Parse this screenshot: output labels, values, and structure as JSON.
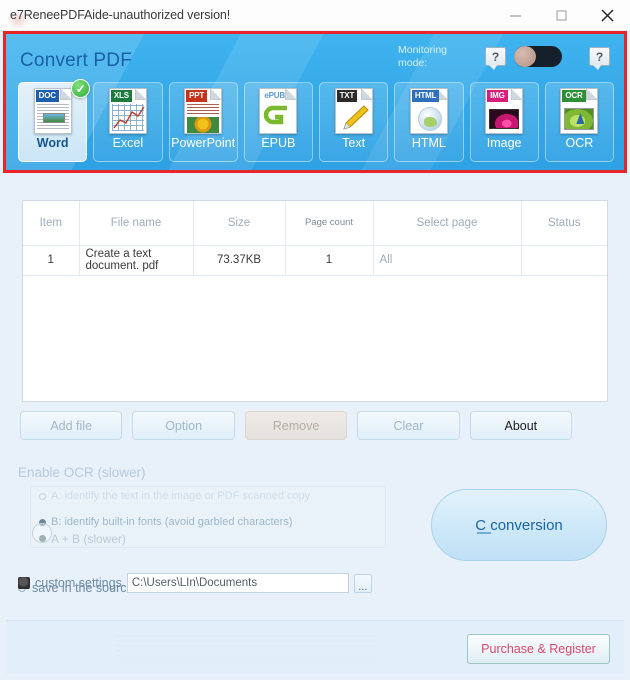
{
  "window": {
    "title": "e7ReneePDFAide-unauthorized version!",
    "minimize_label": "—",
    "maximize_label": "□",
    "close_label": "✕"
  },
  "header": {
    "title": "Convert PDF",
    "monitoring_label": "Monitoring mode:",
    "help_label": "?",
    "toggle_state": "off",
    "accent_color": "#35a9e8",
    "highlight_color": "#e8262a"
  },
  "formats": [
    {
      "label": "Word",
      "tag": "DOC",
      "tag_color": "#1c5fae",
      "selected": true,
      "check": "✓"
    },
    {
      "label": "Excel",
      "tag": "XLS",
      "tag_color": "#1d7a3c",
      "selected": false,
      "check": ""
    },
    {
      "label": "PowerPoint",
      "tag": "PPT",
      "tag_color": "#c8341b",
      "selected": false,
      "check": ""
    },
    {
      "label": "EPUB",
      "tag": "ePUB",
      "tag_color": "#5e9ad2",
      "selected": false,
      "check": ""
    },
    {
      "label": "Text",
      "tag": "TXT",
      "tag_color": "#2b2b2b",
      "selected": false,
      "check": ""
    },
    {
      "label": "HTML",
      "tag": "HTML",
      "tag_color": "#2d6fba",
      "selected": false,
      "check": ""
    },
    {
      "label": "Image",
      "tag": "IMG",
      "tag_color": "#d61f7a",
      "selected": false,
      "check": ""
    },
    {
      "label": "OCR",
      "tag": "OCR",
      "tag_color": "#2f8f37",
      "selected": false,
      "check": ""
    }
  ],
  "table": {
    "headers": [
      "Item",
      "File name",
      "Size",
      "Page count",
      "Select page",
      "Status"
    ],
    "rows": [
      {
        "item": "1",
        "file_name": "Create a text document. pdf",
        "size": "73.37KB",
        "page_count": "1",
        "select_page": "All",
        "status": ""
      }
    ]
  },
  "actions": [
    {
      "label": "Add file",
      "disabled": false
    },
    {
      "label": "Option",
      "disabled": false
    },
    {
      "label": "Remove",
      "disabled": true
    },
    {
      "label": "Clear",
      "disabled": false
    },
    {
      "label": "About",
      "disabled": false
    }
  ],
  "ocr": {
    "title": "Enable OCR (slower)",
    "option_a": "A: identify the text in the image or PDF scanned copy",
    "option_b": "B: identify built-in fonts (avoid garbled characters)",
    "option_ab": "A + B (slower)",
    "selected": "A + B (slower)"
  },
  "output": {
    "save_source_label": "save in the source file folder",
    "custom_label": "custom settings",
    "path_value": "C:\\Users\\LIn\\Documents",
    "browse_label": "..."
  },
  "convert": {
    "label": "C conversion"
  },
  "footer": {
    "purchase_label": "Purchase & Register"
  }
}
